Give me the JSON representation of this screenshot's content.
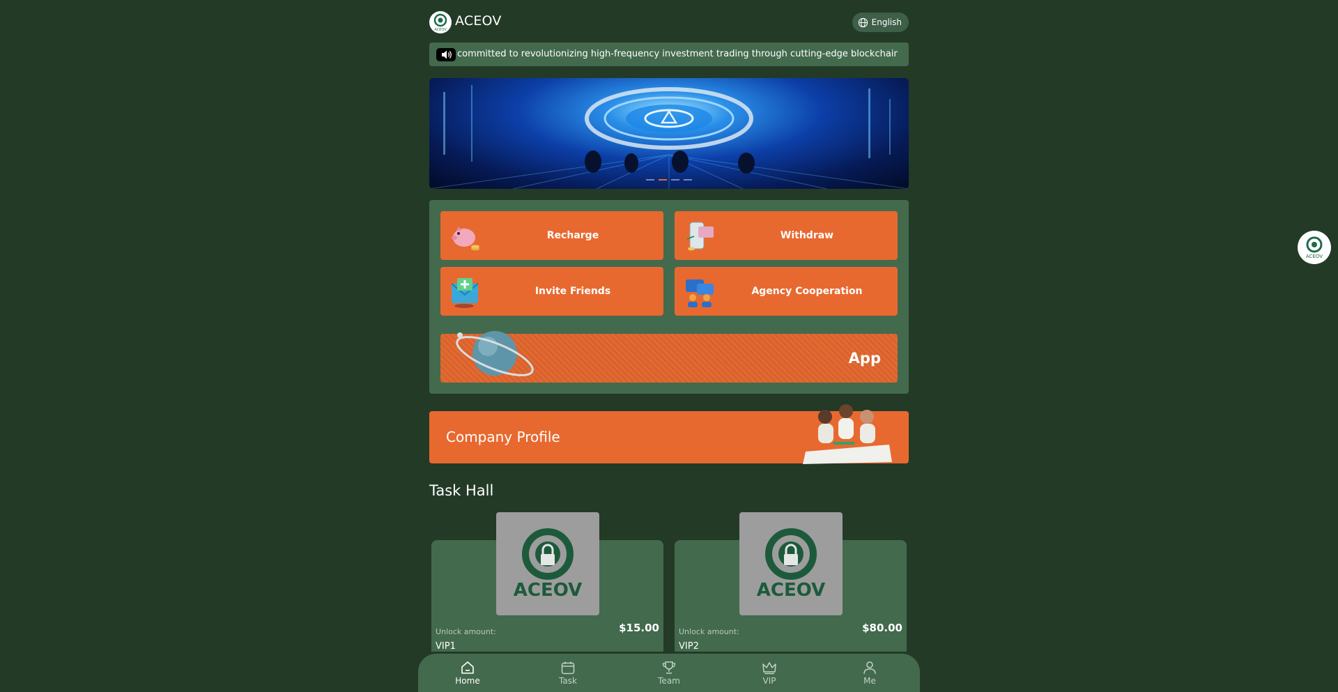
{
  "header": {
    "brand": "ACEOV",
    "logo_text": "ACEOV",
    "language_label": "English"
  },
  "notice": {
    "text": "committed to revolutionizing high-frequency investment trading through cutting-edge blockchain technology"
  },
  "banner": {
    "slide_count": 4,
    "active_slide": 2
  },
  "actions": {
    "recharge": "Recharge",
    "withdraw": "Withdraw",
    "invite": "Invite Friends",
    "agency": "Agency Cooperation",
    "app": "App"
  },
  "profile": {
    "title": "Company Profile"
  },
  "task_hall": {
    "title": "Task Hall",
    "cards": [
      {
        "brand": "ACEOV",
        "unlock_label": "Unlock amount:",
        "price": "$15.00",
        "level": "VIP1"
      },
      {
        "brand": "ACEOV",
        "unlock_label": "Unlock amount:",
        "price": "$80.00",
        "level": "VIP2"
      }
    ]
  },
  "nav": {
    "items": [
      {
        "label": "Home",
        "icon": "home-icon",
        "active": true
      },
      {
        "label": "Task",
        "icon": "calendar-icon",
        "active": false
      },
      {
        "label": "Team",
        "icon": "trophy-icon",
        "active": false
      },
      {
        "label": "VIP",
        "icon": "crown-icon",
        "active": false
      },
      {
        "label": "Me",
        "icon": "user-icon",
        "active": false
      }
    ]
  },
  "colors": {
    "background": "#233a27",
    "panel": "#436a4d",
    "accent": "#e8692f",
    "card_image": "#9d9d9d"
  }
}
